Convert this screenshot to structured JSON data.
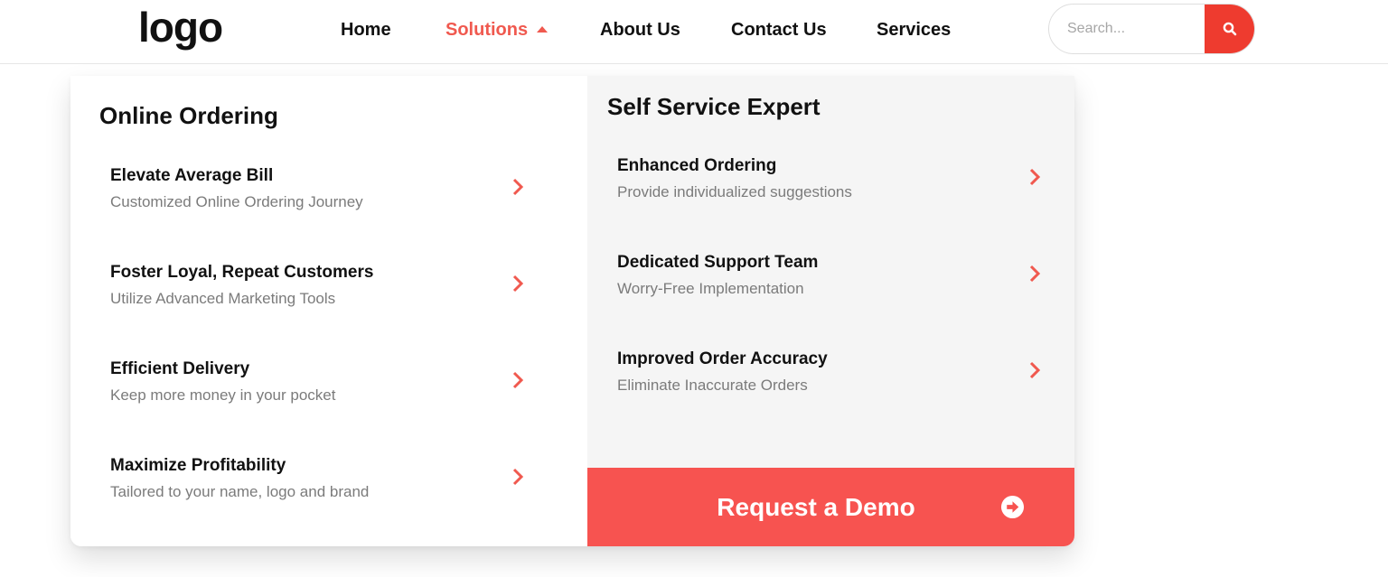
{
  "header": {
    "logo": "logo",
    "nav": [
      {
        "label": "Home"
      },
      {
        "label": "Solutions"
      },
      {
        "label": "About Us"
      },
      {
        "label": "Contact Us"
      },
      {
        "label": "Services"
      }
    ],
    "search": {
      "placeholder": "Search...",
      "value": "",
      "button_icon": "search-icon"
    }
  },
  "menu": {
    "left": {
      "title": "Online Ordering",
      "items": [
        {
          "title": "Elevate Average Bill",
          "subtitle": "Customized Online Ordering Journey"
        },
        {
          "title": "Foster Loyal, Repeat Customers",
          "subtitle": "Utilize Advanced Marketing Tools"
        },
        {
          "title": "Efficient Delivery",
          "subtitle": "Keep more money in your pocket"
        },
        {
          "title": "Maximize Profitability",
          "subtitle": "Tailored to your name, logo and brand"
        }
      ]
    },
    "right": {
      "title": "Self Service Expert",
      "items": [
        {
          "title": "Enhanced Ordering",
          "subtitle": "Provide individualized suggestions"
        },
        {
          "title": "Dedicated Support Team",
          "subtitle": "Worry-Free Implementation"
        },
        {
          "title": "Improved Order Accuracy",
          "subtitle": "Eliminate Inaccurate Orders"
        }
      ],
      "cta": {
        "label": "Request a Demo",
        "icon": "arrow-circle-right-icon"
      }
    }
  },
  "colors": {
    "accent": "#f0594f",
    "search_button": "#ee3b2f",
    "cta_background": "#f75350",
    "right_panel": "#f5f5f5",
    "subtitle": "#7b7b7b"
  }
}
